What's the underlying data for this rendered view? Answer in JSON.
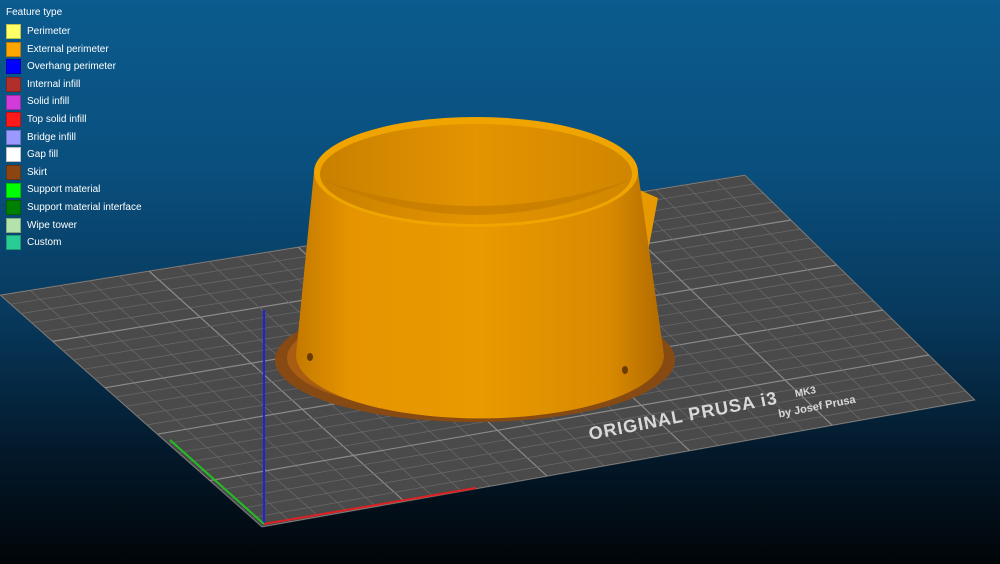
{
  "legend": {
    "title": "Feature type",
    "items": [
      {
        "label": "Perimeter",
        "color": "#ffff66"
      },
      {
        "label": "External perimeter",
        "color": "#ffa500"
      },
      {
        "label": "Overhang perimeter",
        "color": "#0000ff"
      },
      {
        "label": "Internal infill",
        "color": "#b03029"
      },
      {
        "label": "Solid infill",
        "color": "#d03bd9"
      },
      {
        "label": "Top solid infill",
        "color": "#ff1a1a"
      },
      {
        "label": "Bridge infill",
        "color": "#9999ff"
      },
      {
        "label": "Gap fill",
        "color": "#ffffff"
      },
      {
        "label": "Skirt",
        "color": "#8b4513"
      },
      {
        "label": "Support material",
        "color": "#00ff00"
      },
      {
        "label": "Support material interface",
        "color": "#008000"
      },
      {
        "label": "Wipe tower",
        "color": "#b3e3ab"
      },
      {
        "label": "Custom",
        "color": "#28cc94"
      }
    ]
  },
  "bed": {
    "logo_line1": "ORIGINAL PRUSA i3",
    "logo_model": "MK3",
    "logo_line2": "by Josef Prusa"
  },
  "model": {
    "color": "#ffa500"
  },
  "axes": {
    "x_color": "#e02020",
    "y_color": "#20c020",
    "z_color": "#2020e0"
  }
}
